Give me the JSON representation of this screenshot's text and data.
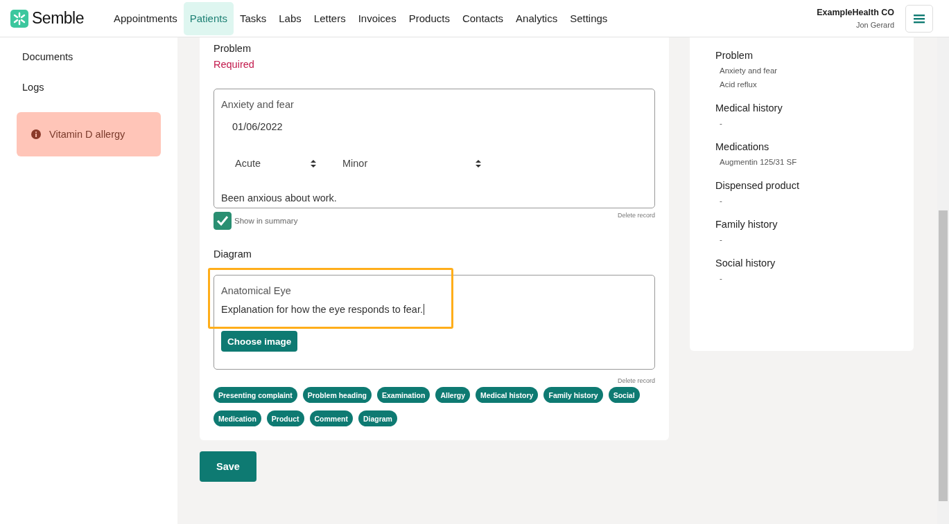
{
  "brand": {
    "name": "Semble"
  },
  "nav": [
    {
      "label": "Appointments",
      "selected": false
    },
    {
      "label": "Patients",
      "selected": true
    },
    {
      "label": "Tasks",
      "selected": false
    },
    {
      "label": "Labs",
      "selected": false
    },
    {
      "label": "Letters",
      "selected": false
    },
    {
      "label": "Invoices",
      "selected": false
    },
    {
      "label": "Products",
      "selected": false
    },
    {
      "label": "Contacts",
      "selected": false
    },
    {
      "label": "Analytics",
      "selected": false
    },
    {
      "label": "Settings",
      "selected": false
    }
  ],
  "account": {
    "organisation": "ExampleHealth CO",
    "user": "Jon Gerard"
  },
  "sidebar": {
    "items": [
      "Documents",
      "Logs"
    ],
    "alert": "Vitamin D allergy"
  },
  "problem_section": {
    "title": "Problem",
    "required": "Required",
    "record": {
      "name": "Anxiety and fear",
      "date": "01/06/2022",
      "onset": "Acute",
      "severity": "Minor",
      "notes": "Been anxious about work."
    },
    "show_in_summary": {
      "label": "Show in summary",
      "checked": true
    },
    "delete": "Delete record"
  },
  "diagram_section": {
    "title": "Diagram",
    "record": {
      "name": "Anatomical Eye",
      "text": "Explanation for how the eye responds to fear."
    },
    "choose_image": "Choose image",
    "delete": "Delete record",
    "highlighted": true
  },
  "tags": [
    "Presenting complaint",
    "Problem heading",
    "Examination",
    "Allergy",
    "Medical history",
    "Family history",
    "Social",
    "Medication",
    "Product",
    "Comment",
    "Diagram"
  ],
  "save": "Save",
  "summary": [
    {
      "title": "Problem",
      "items": [
        "Anxiety and fear",
        "Acid reflux"
      ]
    },
    {
      "title": "Medical history",
      "items": [
        "-"
      ]
    },
    {
      "title": "Medications",
      "items": [
        "Augmentin 125/31 SF"
      ]
    },
    {
      "title": "Dispensed product",
      "items": [
        "-"
      ]
    },
    {
      "title": "Family history",
      "items": [
        "-"
      ]
    },
    {
      "title": "Social history",
      "items": [
        "-"
      ]
    }
  ]
}
